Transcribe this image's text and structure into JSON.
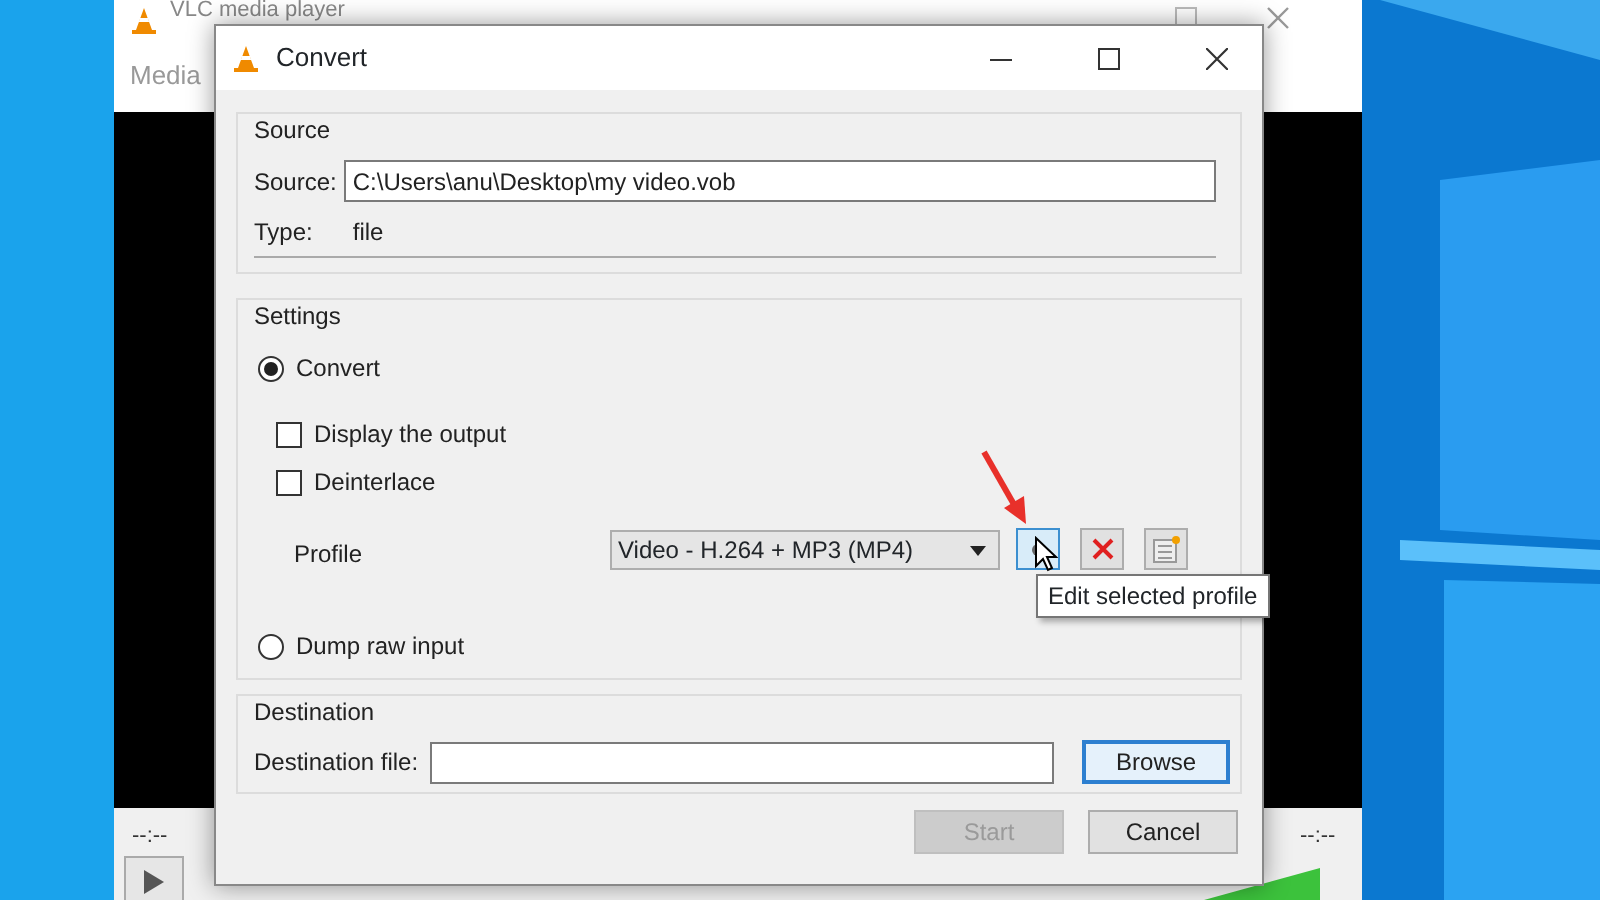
{
  "background_window": {
    "title": "VLC media player",
    "menu": "Media",
    "time_elapsed": "--:--",
    "time_total": "--:--"
  },
  "dialog": {
    "title": "Convert",
    "source": {
      "legend": "Source",
      "source_label": "Source:",
      "source_value": "C:\\Users\\anu\\Desktop\\my video.vob",
      "type_label": "Type:",
      "type_value": "file"
    },
    "settings": {
      "legend": "Settings",
      "convert": {
        "label": "Convert",
        "selected": true
      },
      "checkboxes": [
        {
          "label": "Display the output",
          "checked": false
        },
        {
          "label": "Deinterlace",
          "checked": false
        }
      ],
      "profile": {
        "label": "Profile",
        "value": "Video - H.264 + MP3 (MP4)",
        "tooltip": "Edit selected profile"
      },
      "dump_raw": {
        "label": "Dump raw input",
        "selected": false
      }
    },
    "destination": {
      "legend": "Destination",
      "label": "Destination file:",
      "button": "Browse"
    },
    "buttons": [
      {
        "label": "Start",
        "disabled": true
      },
      {
        "label": "Cancel",
        "disabled": false
      }
    ]
  }
}
